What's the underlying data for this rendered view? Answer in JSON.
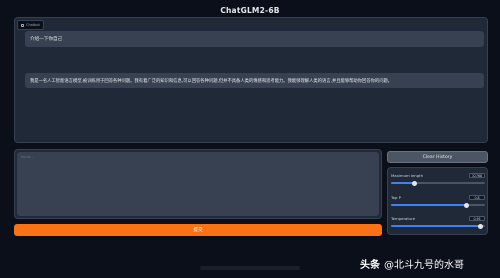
{
  "app": {
    "title": "ChatGLM2-6B"
  },
  "chatbot": {
    "label": "Chatbot",
    "messages": [
      {
        "role": "user",
        "text": "介绍一下你自己"
      },
      {
        "role": "assistant",
        "text": "我是一名人工智能语言模型,被训练用于回答各种问题。我有着广泛的知识和信息,可以回答各种问题,但并不具备人类的情感和思考能力。我能够理解人类的语言,并且能够帮助你回答你的问题。"
      }
    ]
  },
  "input": {
    "placeholder": "Input...",
    "value": ""
  },
  "buttons": {
    "submit_label": "提交",
    "clear_label": "Clear History"
  },
  "params": [
    {
      "label": "Maximum length",
      "value": "32768",
      "fraction": 0.25
    },
    {
      "label": "Top P",
      "value": "0.8",
      "fraction": 0.8
    },
    {
      "label": "Temperature",
      "value": "0.95",
      "fraction": 0.95
    }
  ],
  "watermark": {
    "brand": "头条",
    "handle": "@北斗九号的水哥"
  },
  "colors": {
    "background": "#0b0f19",
    "panel": "#1f2937",
    "accent": "#f97316",
    "slider": "#3b82f6"
  }
}
